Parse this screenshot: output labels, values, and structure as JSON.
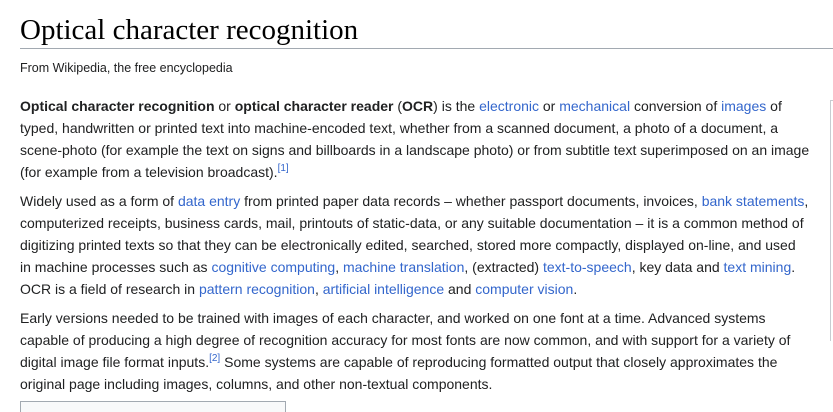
{
  "title": "Optical character recognition",
  "tagline": "From Wikipedia, the free encyclopedia",
  "p1": {
    "b1": "Optical character recognition",
    "t1": " or ",
    "b2": "optical character reader",
    "t2": " (",
    "b3": "OCR",
    "t3": ") is the ",
    "l1": "electronic",
    "t4": " or ",
    "l2": "mechanical",
    "t5": " conversion of ",
    "l3": "images",
    "t6": " of typed, handwritten or printed text into machine-encoded text, whether from a scanned document, a photo of a document, a scene-photo (for example the text on signs and billboards in a landscape photo) or from subtitle text superimposed on an image (for example from a television broadcast).",
    "ref": "[1]"
  },
  "p2": {
    "t1": "Widely used as a form of ",
    "l1": "data entry",
    "t2": " from printed paper data records – whether passport documents, invoices, ",
    "l2": "bank statements",
    "t3": ", computerized receipts, business cards, mail, printouts of static-data, or any suitable documentation – it is a common method of digitizing printed texts so that they can be electronically edited, searched, stored more compactly, displayed on-line, and used in machine processes such as ",
    "l3": "cognitive computing",
    "t4": ", ",
    "l4": "machine translation",
    "t5": ", (extracted) ",
    "l5": "text-to-speech",
    "t6": ", key data and ",
    "l6": "text mining",
    "t7": ". OCR is a field of research in ",
    "l7": "pattern recognition",
    "t8": ", ",
    "l8": "artificial intelligence",
    "t9": " and ",
    "l9": "computer vision",
    "t10": "."
  },
  "p3": {
    "t1": "Early versions needed to be trained with images of each character, and worked on one font at a time. Advanced systems capable of producing a high degree of recognition accuracy for most fonts are now common, and with support for a variety of digital image file format inputs.",
    "ref": "[2]",
    "t2": " Some systems are capable of reproducing formatted output that closely approximates the original page including images, columns, and other non-textual components."
  },
  "colors": {
    "link": "#3366cc",
    "text": "#202122",
    "rule": "#a2a9b1"
  }
}
